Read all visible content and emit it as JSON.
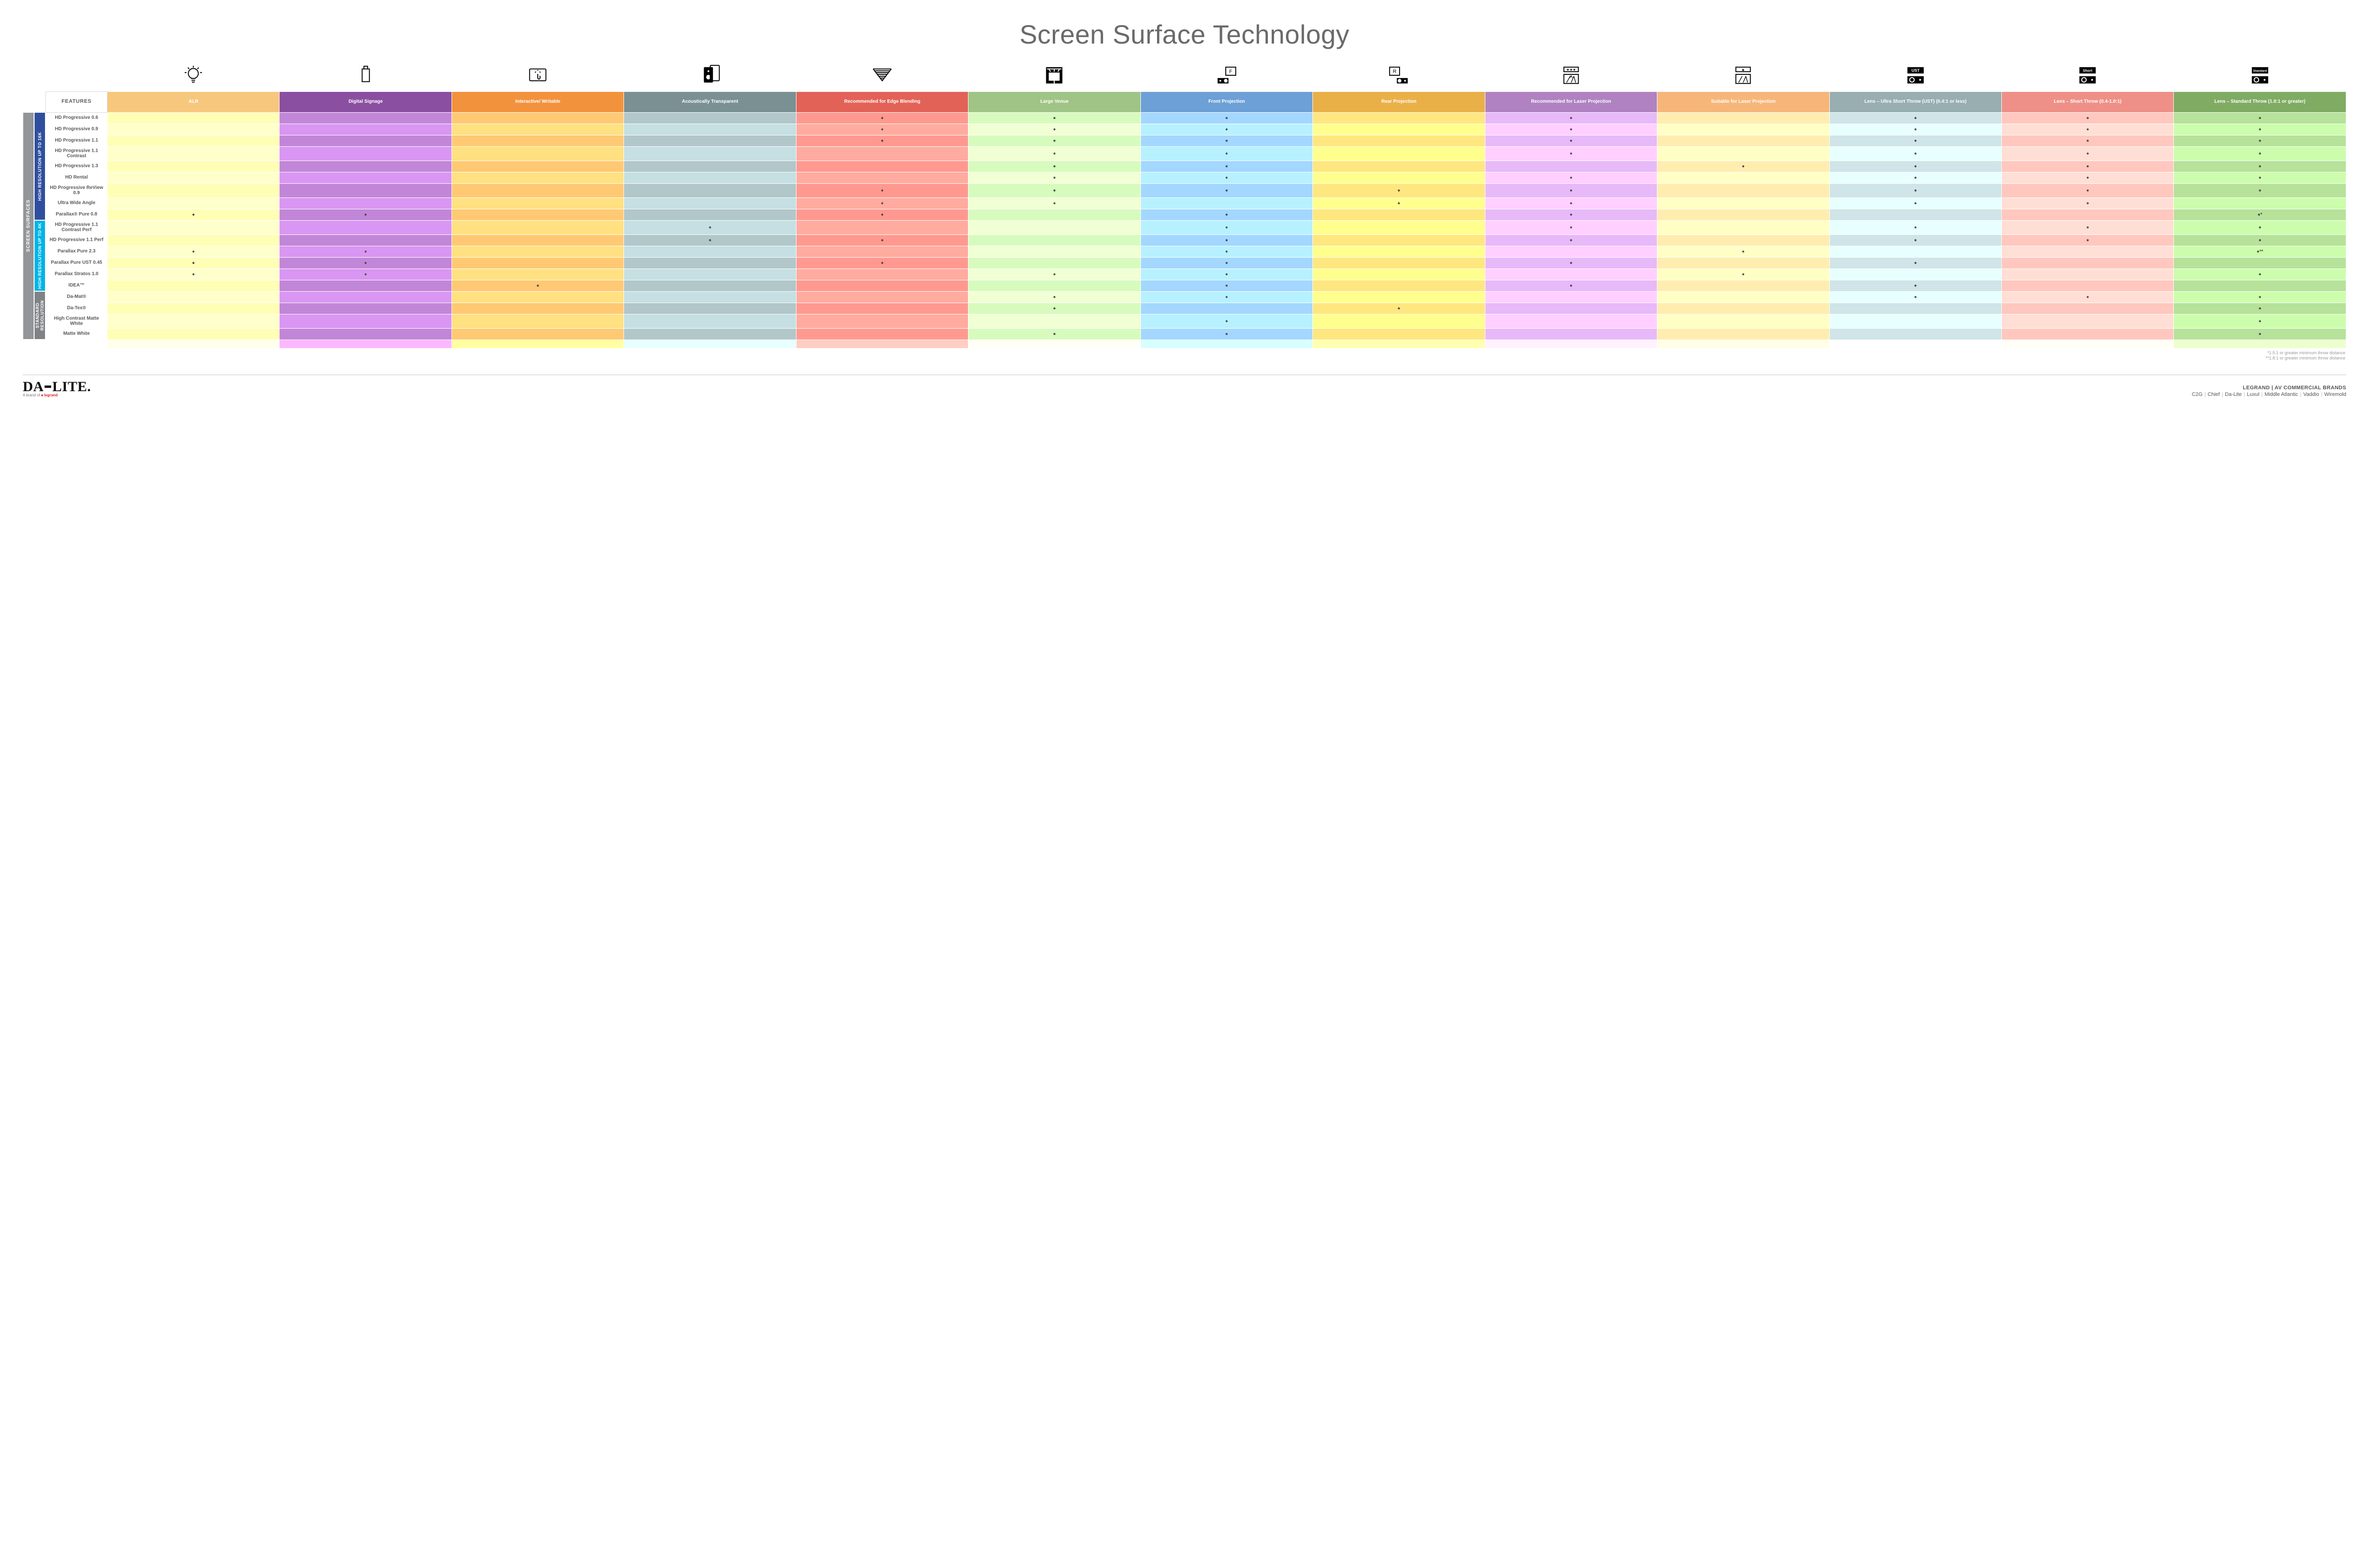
{
  "title": "Screen Surface Technology",
  "outer_band": "SCREEN SURFACES",
  "bands": [
    {
      "id": "16k",
      "label": "HIGH RESOLUTION UP TO 16K",
      "rows": 9
    },
    {
      "id": "4k",
      "label": "HIGH RESOLUTION UP TO 4K",
      "rows": 6
    },
    {
      "id": "std",
      "label": "STANDARD RESOLUTION",
      "rows": 4
    }
  ],
  "columns": [
    {
      "id": "alr",
      "label": "ALR",
      "color": "#f7c77e",
      "icon": "lightbulb"
    },
    {
      "id": "signage",
      "label": "Digital Signage",
      "color": "#8b4fa1",
      "icon": "signage"
    },
    {
      "id": "interactive",
      "label": "Interactive/ Writable",
      "color": "#f3923c",
      "icon": "touch"
    },
    {
      "id": "acoustic",
      "label": "Acoustically Transparent",
      "color": "#7a9093",
      "icon": "speaker"
    },
    {
      "id": "edge",
      "label": "Recommended for Edge Blending",
      "color": "#e36258",
      "icon": "blend"
    },
    {
      "id": "large",
      "label": "Large Venue",
      "color": "#a0c486",
      "icon": "venue"
    },
    {
      "id": "front",
      "label": "Front Projection",
      "color": "#6ca0d6",
      "icon": "front"
    },
    {
      "id": "rear",
      "label": "Rear Projection",
      "color": "#eab048",
      "icon": "rear"
    },
    {
      "id": "reclaser",
      "label": "Recommended for Laser Projection",
      "color": "#b082c2",
      "icon": "laser3"
    },
    {
      "id": "suitlaser",
      "label": "Suitable for Laser Projection",
      "color": "#f7b679",
      "icon": "laser1"
    },
    {
      "id": "ust",
      "label": "Lens – Ultra Short Throw (UST) (0.4:1 or less)",
      "color": "#98aeb0",
      "icon": "ust"
    },
    {
      "id": "short",
      "label": "Lens – Short Throw (0.4-1.0:1)",
      "color": "#ee9087",
      "icon": "short"
    },
    {
      "id": "standard",
      "label": "Lens – Standard Throw (1.0:1 or greater)",
      "color": "#7fab63",
      "icon": "std"
    }
  ],
  "features_header": "FEATURES",
  "rows": [
    {
      "band": "16k",
      "name": "HD Progressive 0.6",
      "dots": {
        "edge": "●",
        "large": "●",
        "front": "●",
        "reclaser": "●",
        "ust": "●",
        "short": "●",
        "standard": "●"
      }
    },
    {
      "band": "16k",
      "name": "HD Progressive 0.9",
      "dots": {
        "edge": "●",
        "large": "●",
        "front": "●",
        "reclaser": "●",
        "ust": "●",
        "short": "●",
        "standard": "●"
      }
    },
    {
      "band": "16k",
      "name": "HD Progressive 1.1",
      "dots": {
        "edge": "●",
        "large": "●",
        "front": "●",
        "reclaser": "●",
        "ust": "●",
        "short": "●",
        "standard": "●"
      }
    },
    {
      "band": "16k",
      "name": "HD Progressive 1.1 Contrast",
      "dots": {
        "large": "●",
        "front": "●",
        "reclaser": "●",
        "ust": "●",
        "short": "●",
        "standard": "●"
      }
    },
    {
      "band": "16k",
      "name": "HD Progressive 1.3",
      "dots": {
        "large": "●",
        "front": "●",
        "suitlaser": "●",
        "ust": "●",
        "short": "●",
        "standard": "●"
      }
    },
    {
      "band": "16k",
      "name": "HD Rental",
      "dots": {
        "large": "●",
        "front": "●",
        "reclaser": "●",
        "ust": "●",
        "short": "●",
        "standard": "●"
      }
    },
    {
      "band": "16k",
      "name": "HD Progressive ReView 0.9",
      "dots": {
        "edge": "●",
        "large": "●",
        "front": "●",
        "rear": "●",
        "reclaser": "●",
        "ust": "●",
        "short": "●",
        "standard": "●"
      }
    },
    {
      "band": "16k",
      "name": "Ultra Wide Angle",
      "dots": {
        "edge": "●",
        "large": "●",
        "rear": "●",
        "reclaser": "●",
        "ust": "●",
        "short": "●"
      }
    },
    {
      "band": "16k",
      "name": "Parallax® Pure 0.8",
      "dots": {
        "alr": "●",
        "signage": "●",
        "edge": "●",
        "front": "●",
        "reclaser": "●",
        "standard": "●*"
      }
    },
    {
      "band": "4k",
      "name": "HD Progressive 1.1 Contrast Perf",
      "dots": {
        "acoustic": "●",
        "front": "●",
        "reclaser": "●",
        "ust": "●",
        "short": "●",
        "standard": "●"
      }
    },
    {
      "band": "4k",
      "name": "HD Progressive 1.1 Perf",
      "dots": {
        "acoustic": "●",
        "edge": "●",
        "front": "●",
        "reclaser": "●",
        "ust": "●",
        "short": "●",
        "standard": "●"
      }
    },
    {
      "band": "4k",
      "name": "Parallax Pure 2.3",
      "dots": {
        "alr": "●",
        "signage": "●",
        "front": "●",
        "suitlaser": "●",
        "standard": "●**"
      }
    },
    {
      "band": "4k",
      "name": "Parallax Pure UST 0.45",
      "dots": {
        "alr": "●",
        "signage": "●",
        "edge": "●",
        "front": "●",
        "reclaser": "●",
        "ust": "●"
      }
    },
    {
      "band": "4k",
      "name": "Parallax Stratos 1.0",
      "dots": {
        "alr": "●",
        "signage": "●",
        "large": "●",
        "front": "●",
        "suitlaser": "●",
        "standard": "●"
      }
    },
    {
      "band": "4k",
      "name": "IDEA™",
      "dots": {
        "interactive": "●",
        "front": "●",
        "reclaser": "●",
        "ust": "●"
      }
    },
    {
      "band": "std",
      "name": "Da-Mat®",
      "dots": {
        "large": "●",
        "front": "●",
        "ust": "●",
        "short": "●",
        "standard": "●"
      }
    },
    {
      "band": "std",
      "name": "Da-Tex®",
      "dots": {
        "large": "●",
        "rear": "●",
        "standard": "●"
      }
    },
    {
      "band": "std",
      "name": "High Contrast Matte White",
      "dots": {
        "front": "●",
        "standard": "●"
      }
    },
    {
      "band": "std",
      "name": "Matte White",
      "dots": {
        "large": "●",
        "front": "●",
        "standard": "●"
      }
    }
  ],
  "footnotes": [
    "*1.5:1 or greater minimum throw distance",
    "**1.8:1 or greater minimum throw distance"
  ],
  "footer": {
    "logo_main": "DA·LITE.",
    "logo_sub_prefix": "A brand of ",
    "logo_sub_brand": "legrand",
    "brands_title": "LEGRAND | AV COMMERCIAL BRANDS",
    "brands": [
      "C2G",
      "Chief",
      "Da-Lite",
      "Luxul",
      "Middle Atlantic",
      "Vaddio",
      "Wiremold"
    ]
  }
}
